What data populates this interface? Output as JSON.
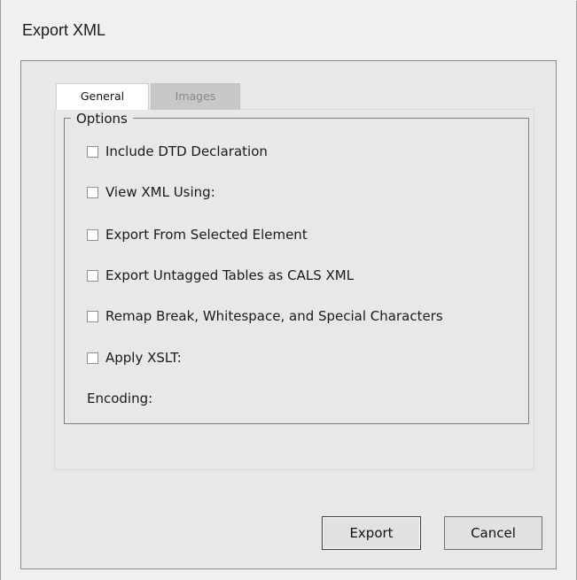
{
  "window": {
    "title": "Export XML"
  },
  "tabs": [
    {
      "label": "General",
      "active": true
    },
    {
      "label": "Images",
      "active": false
    }
  ],
  "options": {
    "legend": "Options",
    "checkboxes": [
      {
        "label": "Include DTD Declaration",
        "checked": false
      },
      {
        "label": "View XML Using:",
        "checked": false
      },
      {
        "label": "Export From Selected Element",
        "checked": false
      },
      {
        "label": "Export Untagged Tables as CALS XML",
        "checked": false
      },
      {
        "label": "Remap Break, Whitespace, and Special Characters",
        "checked": false
      },
      {
        "label": "Apply XSLT:",
        "checked": false
      }
    ],
    "encoding_label": "Encoding:"
  },
  "buttons": {
    "export_label": "Export",
    "cancel_label": "Cancel"
  }
}
